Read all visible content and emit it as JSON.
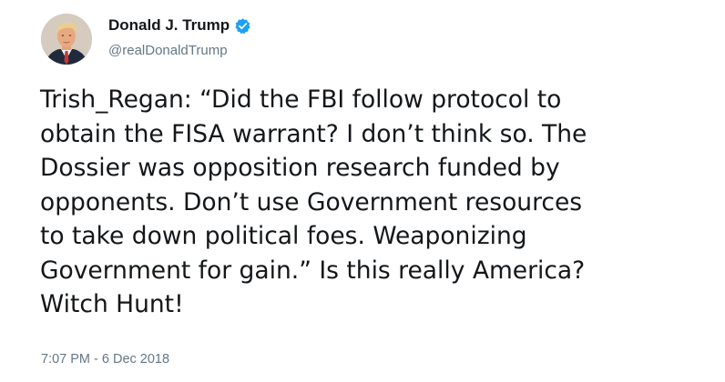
{
  "tweet": {
    "author": {
      "display_name": "Donald J. Trump",
      "handle": "@realDonaldTrump",
      "verified": true,
      "avatar_icon": "profile-photo",
      "verified_icon": "verified-badge-icon"
    },
    "text": "Trish_Regan:  “Did the FBI follow protocol to\nobtain the FISA warrant? I don’t think so. The\nDossier was opposition research funded by\nopponents. Don’t use Government resources\nto take down political foes. Weaponizing\nGovernment for gain.” Is this really America?\nWitch Hunt!",
    "timestamp": "7:07 PM - 6 Dec 2018"
  },
  "colors": {
    "text": "#14171a",
    "secondary": "#657786",
    "verified_blue": "#1da1f2",
    "background": "#ffffff"
  }
}
